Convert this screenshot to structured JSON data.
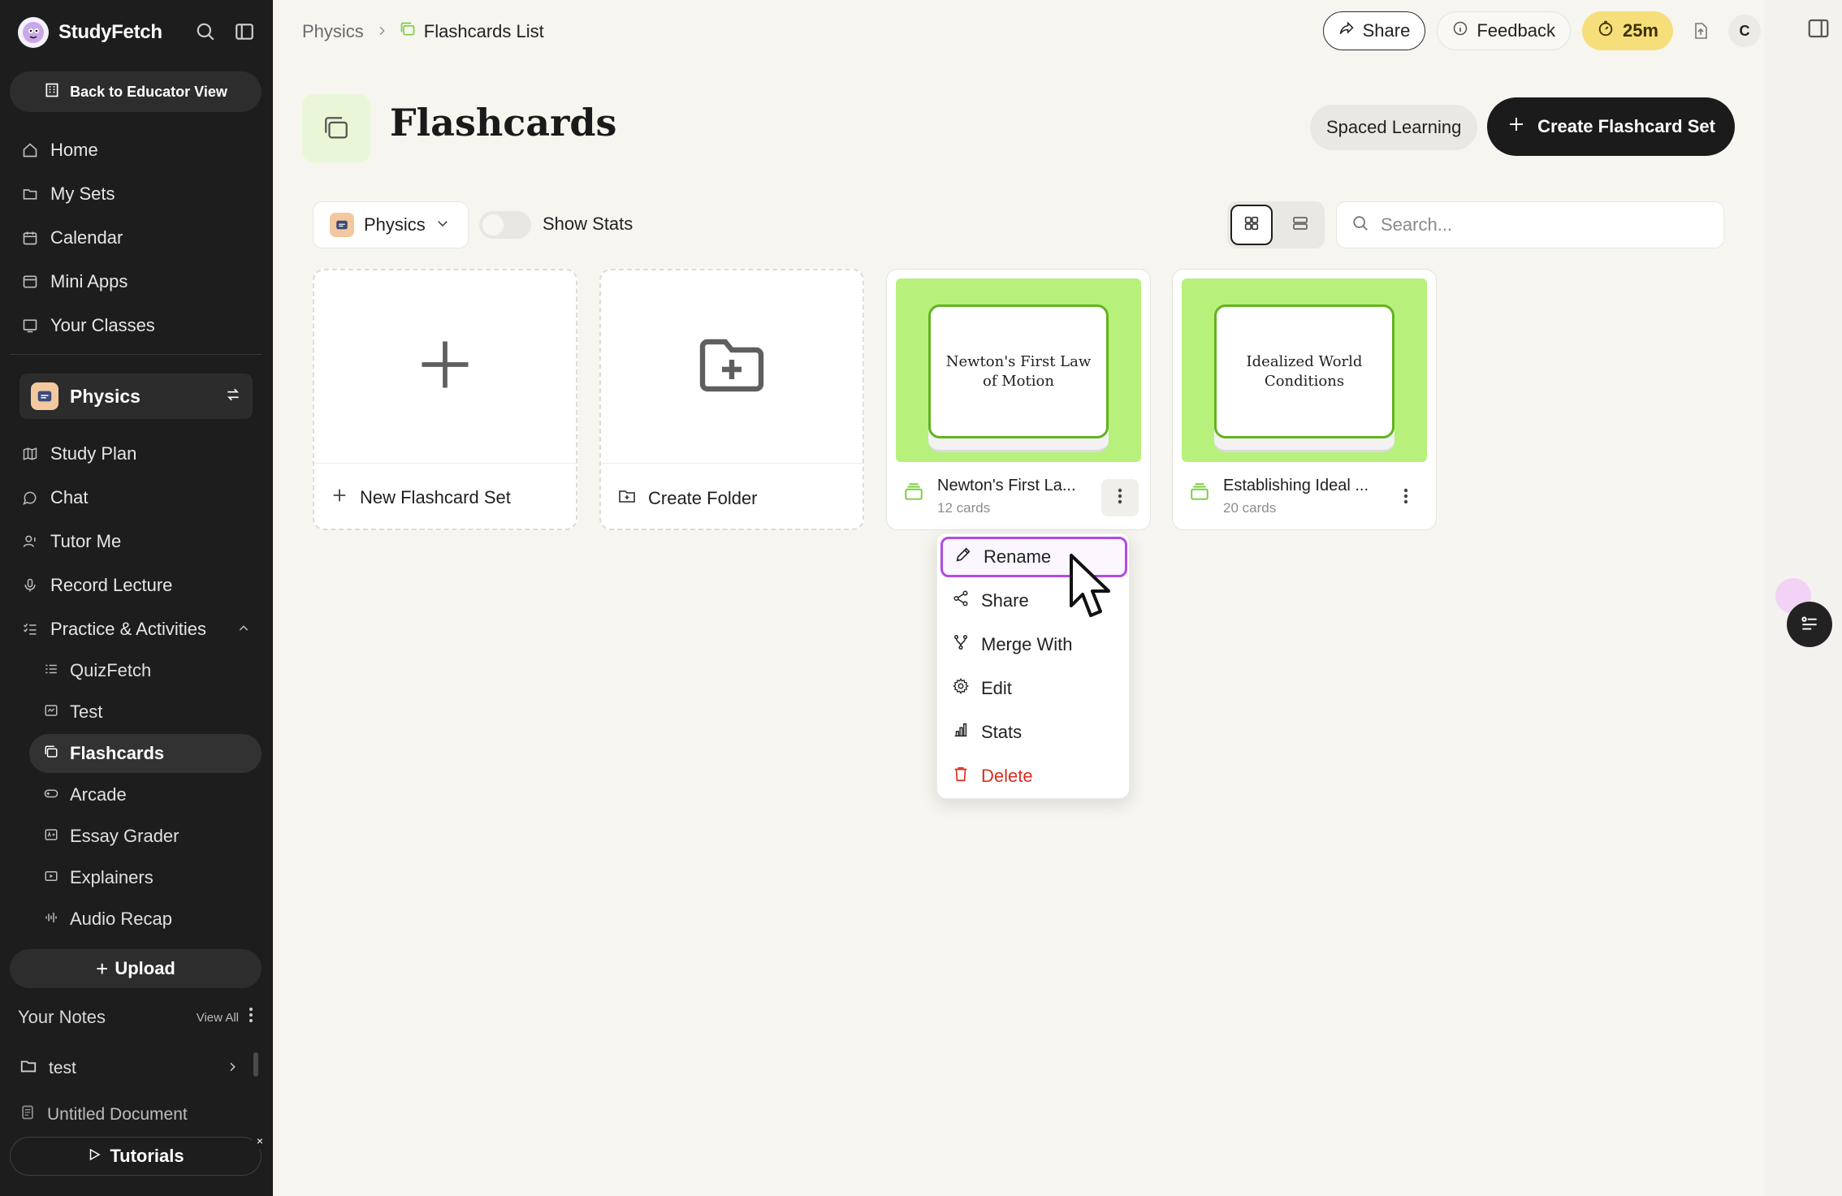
{
  "brand": {
    "name": "StudyFetch"
  },
  "sidebar": {
    "educator_btn": "Back to Educator View",
    "nav": [
      {
        "label": "Home",
        "icon": "home-icon"
      },
      {
        "label": "My Sets",
        "icon": "folder-icon"
      },
      {
        "label": "Calendar",
        "icon": "calendar-icon"
      },
      {
        "label": "Mini Apps",
        "icon": "app-window-icon"
      },
      {
        "label": "Your Classes",
        "icon": "classes-icon"
      }
    ],
    "class_name": "Physics",
    "class_nav": [
      {
        "label": "Study Plan",
        "icon": "map-icon"
      },
      {
        "label": "Chat",
        "icon": "chat-icon"
      },
      {
        "label": "Tutor Me",
        "icon": "tutor-icon"
      },
      {
        "label": "Record Lecture",
        "icon": "microphone-icon"
      },
      {
        "label": "Practice & Activities",
        "icon": "list-checks-icon"
      }
    ],
    "activities": [
      {
        "label": "QuizFetch",
        "icon": "quiz-icon"
      },
      {
        "label": "Test",
        "icon": "test-icon"
      },
      {
        "label": "Flashcards",
        "icon": "flashcards-icon",
        "active": true
      },
      {
        "label": "Arcade",
        "icon": "gamepad-icon"
      },
      {
        "label": "Essay Grader",
        "icon": "grader-icon"
      },
      {
        "label": "Explainers",
        "icon": "video-icon"
      },
      {
        "label": "Audio Recap",
        "icon": "audio-wave-icon"
      }
    ],
    "upload": "Upload",
    "notes_title": "Your Notes",
    "view_all": "View All",
    "notes": [
      {
        "label": "test",
        "icon": "folder-icon"
      },
      {
        "label": "Untitled Document",
        "icon": "document-icon"
      }
    ],
    "tutorials": "Tutorials"
  },
  "topbar": {
    "breadcrumb": [
      "Physics",
      "Flashcards List"
    ],
    "share": "Share",
    "feedback": "Feedback",
    "timer": "25m",
    "avatar": "C"
  },
  "header": {
    "title": "Flashcards",
    "spaced": "Spaced Learning",
    "create": "Create Flashcard Set"
  },
  "filters": {
    "class": "Physics",
    "show_stats": "Show Stats",
    "search_placeholder": "Search..."
  },
  "cards": {
    "new_set": "New Flashcard Set",
    "new_folder": "Create Folder",
    "sets": [
      {
        "thumb": "Newton's First Law of Motion",
        "name": "Newton's First La...",
        "count": "12 cards"
      },
      {
        "thumb": "Idealized World Conditions",
        "name": "Establishing Ideal ...",
        "count": "20 cards"
      }
    ]
  },
  "menu": {
    "items": [
      {
        "label": "Rename",
        "icon": "pencil-icon"
      },
      {
        "label": "Share",
        "icon": "share-nodes-icon"
      },
      {
        "label": "Merge With",
        "icon": "merge-icon"
      },
      {
        "label": "Edit",
        "icon": "gear-icon"
      },
      {
        "label": "Stats",
        "icon": "bar-chart-icon"
      },
      {
        "label": "Delete",
        "icon": "trash-icon"
      }
    ]
  },
  "colors": {
    "accent_green": "#b8f07c",
    "highlight": "#b24be0",
    "danger": "#d92d20",
    "timer": "#f6de7a"
  }
}
